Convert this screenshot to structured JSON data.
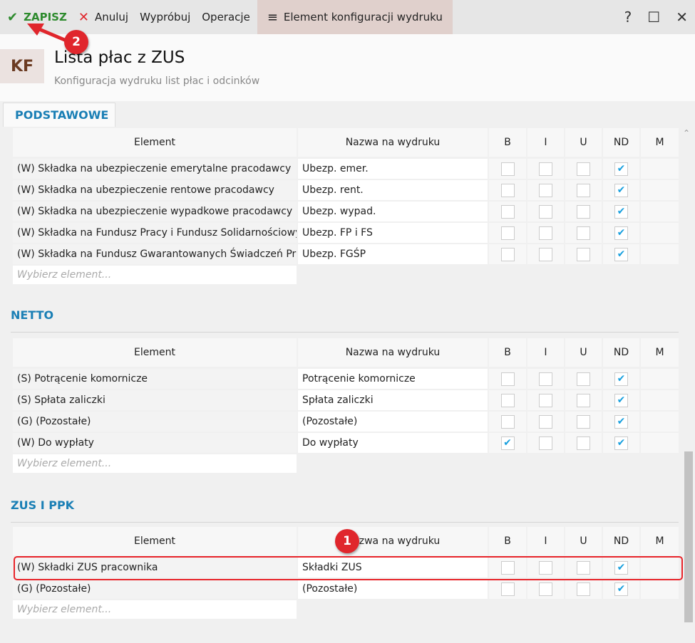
{
  "toolbar": {
    "save": "ZAPISZ",
    "cancel": "Anuluj",
    "try": "Wypróbuj",
    "operations": "Operacje",
    "context": "Element konfiguracji wydruku",
    "help": "?",
    "maximize": "☐",
    "close": "✕"
  },
  "header": {
    "badge": "KF",
    "title": "Lista płac z ZUS",
    "subtitle": "Konfiguracja wydruku list płac i odcinków"
  },
  "tab": "PODSTAWOWE",
  "columns": [
    "Element",
    "Nazwa na wydruku",
    "B",
    "I",
    "U",
    "ND",
    "M"
  ],
  "picker_placeholder": "Wybierz element...",
  "sections": [
    {
      "title": "",
      "rows": [
        {
          "element": "(W) Składka na ubezpieczenie emerytalne pracodawcy",
          "name": "Ubezp. emer.",
          "B": false,
          "I": false,
          "U": false,
          "ND": true
        },
        {
          "element": "(W) Składka na ubezpieczenie rentowe pracodawcy",
          "name": "Ubezp. rent.",
          "B": false,
          "I": false,
          "U": false,
          "ND": true
        },
        {
          "element": "(W) Składka na ubezpieczenie wypadkowe pracodawcy",
          "name": "Ubezp. wypad.",
          "B": false,
          "I": false,
          "U": false,
          "ND": true
        },
        {
          "element": "(W) Składka na Fundusz Pracy i Fundusz Solidarnościowy",
          "name": "Ubezp. FP i FS",
          "B": false,
          "I": false,
          "U": false,
          "ND": true
        },
        {
          "element": "(W) Składka na Fundusz Gwarantowanych Świadczeń Pracowniczych",
          "name": "Ubezp. FGŚP",
          "B": false,
          "I": false,
          "U": false,
          "ND": true
        }
      ]
    },
    {
      "title": "NETTO",
      "rows": [
        {
          "element": "(S) Potrącenie komornicze",
          "name": "Potrącenie komornicze",
          "B": false,
          "I": false,
          "U": false,
          "ND": true
        },
        {
          "element": "(S) Spłata zaliczki",
          "name": "Spłata zaliczki",
          "B": false,
          "I": false,
          "U": false,
          "ND": true
        },
        {
          "element": "(G) (Pozostałe)",
          "name": "(Pozostałe)",
          "B": false,
          "I": false,
          "U": false,
          "ND": true
        },
        {
          "element": "(W) Do wypłaty",
          "name": "Do wypłaty",
          "B": true,
          "I": false,
          "U": false,
          "ND": true
        }
      ]
    },
    {
      "title": "ZUS I PPK",
      "rows": [
        {
          "element": "(W) Składki ZUS pracownika",
          "name": "Składki ZUS",
          "B": false,
          "I": false,
          "U": false,
          "ND": true
        },
        {
          "element": "(G) (Pozostałe)",
          "name": "(Pozostałe)",
          "B": false,
          "I": false,
          "U": false,
          "ND": true
        }
      ]
    }
  ],
  "annotations": {
    "step1": "1",
    "step2": "2"
  },
  "colors": {
    "accent": "#1a7fb5",
    "save": "#2e8b2e",
    "highlight": "#e8242a"
  }
}
